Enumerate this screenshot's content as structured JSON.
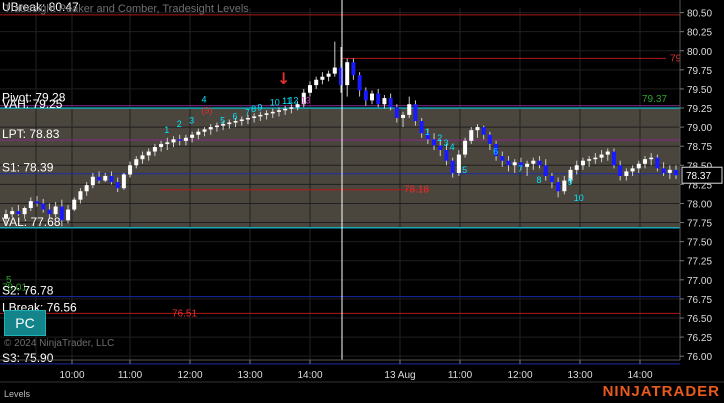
{
  "window": {
    "title": "Tradesight Peaker and Comber, Tradesight Levels",
    "copyright": "© 2024 NinjaTrader, LLC",
    "brand": "NINJATRADER",
    "panel_label": "Levels",
    "pc_button": "PC"
  },
  "colors": {
    "background": "#000000",
    "value_area_fill": "#4a463e",
    "up_candle": "#ffffff",
    "down_candle": "#1a1aff",
    "wick": "#cccccc",
    "axis_text": "#dddddd",
    "cyan": "#00e5ff",
    "red_line": "#b01818",
    "blue_line": "#1c2aa8",
    "purple_line": "#8a2a8a",
    "green_text": "#2aa52a",
    "red_text": "#e03030",
    "magenta_text": "#d040d0"
  },
  "chart_data": {
    "type": "candlestick",
    "ylim": [
      75.89,
      80.66
    ],
    "x_ticks": [
      "10:00",
      "11:00",
      "12:00",
      "13:00",
      "14:00",
      "13 Aug",
      "11:00",
      "12:00",
      "13:00",
      "14:00"
    ],
    "y_ticks": [
      "80.50",
      "80.25",
      "80.00",
      "79.75",
      "79.50",
      "79.25",
      "79.00",
      "78.75",
      "78.50",
      "78.25",
      "78.00",
      "77.75",
      "77.50",
      "77.25",
      "77.00",
      "76.75",
      "76.50",
      "76.25",
      "76.00"
    ],
    "last_price": "78.37",
    "levels": [
      {
        "name": "UBreak",
        "label": "UBreak: 80.47",
        "value": 80.47,
        "color": "#b01818"
      },
      {
        "name": "Pivot",
        "label": "Pivot: 79.28",
        "value": 79.28,
        "color": "#8a2a8a"
      },
      {
        "name": "VAH",
        "label": "VAH: 79.25",
        "value": 79.25,
        "color": "#00e5ff"
      },
      {
        "name": "LPT",
        "label": "LPT: 78.83",
        "value": 78.83,
        "color": "#8a2a8a"
      },
      {
        "name": "S1",
        "label": "S1: 78.39",
        "value": 78.39,
        "color": "#1c2aa8"
      },
      {
        "name": "VAL",
        "label": "VAL: 77.68",
        "value": 77.68,
        "color": "#00e5ff"
      },
      {
        "name": "S2",
        "label": "S2: 76.78",
        "value": 76.78,
        "color": "#1c2aa8"
      },
      {
        "name": "LBreak",
        "label": "LBreak: 76.56",
        "value": 76.56,
        "color": "#b01818"
      },
      {
        "name": "S3",
        "label": "S3: 75.90",
        "value": 75.9,
        "color": "#1c2aa8"
      }
    ],
    "value_area": [
      77.68,
      79.25
    ],
    "price_labels": [
      {
        "text": "79",
        "value": 79.9,
        "color": "#e03030"
      },
      {
        "text": "79.37",
        "value": 79.37,
        "color": "#2aa52a"
      },
      {
        "text": "78.18",
        "value": 78.18,
        "color": "#e03030"
      },
      {
        "text": "76.51",
        "value": 76.56,
        "color": "#e03030"
      },
      {
        "text": "78.01",
        "value": 76.9,
        "color": "#2aa52a"
      },
      {
        "text": "5",
        "value": 77.0,
        "color": "#2aa52a"
      }
    ],
    "count_labels": [
      {
        "text": "1",
        "bar": 26,
        "value": 78.92,
        "color": "#00e5ff"
      },
      {
        "text": "2",
        "bar": 28,
        "value": 79.0,
        "color": "#00e5ff"
      },
      {
        "text": "3",
        "bar": 30,
        "value": 79.05,
        "color": "#00e5ff"
      },
      {
        "text": "4",
        "bar": 32,
        "value": 79.32,
        "color": "#00e5ff"
      },
      {
        "text": "5",
        "bar": 35,
        "value": 79.05,
        "color": "#00e5ff"
      },
      {
        "text": "6",
        "bar": 37,
        "value": 79.1,
        "color": "#00e5ff"
      },
      {
        "text": "7",
        "bar": 39,
        "value": 79.15,
        "color": "#00e5ff"
      },
      {
        "text": "8",
        "bar": 40,
        "value": 79.2,
        "color": "#00e5ff"
      },
      {
        "text": "9",
        "bar": 41,
        "value": 79.22,
        "color": "#00e5ff"
      },
      {
        "text": "10",
        "bar": 43,
        "value": 79.28,
        "color": "#00e5ff"
      },
      {
        "text": "11",
        "bar": 45,
        "value": 79.3,
        "color": "#00e5ff"
      },
      {
        "text": "12",
        "bar": 46,
        "value": 79.31,
        "color": "#00e5ff"
      },
      {
        "text": "13",
        "bar": 48,
        "value": 79.31,
        "color": "#d040d0"
      },
      {
        "text": "(9)",
        "bar": 32,
        "value": 79.18,
        "color": "#e03030"
      },
      {
        "text": "1",
        "bar": 68,
        "value": 78.9,
        "color": "#00e5ff"
      },
      {
        "text": "2",
        "bar": 70,
        "value": 78.82,
        "color": "#00e5ff"
      },
      {
        "text": "3",
        "bar": 71,
        "value": 78.75,
        "color": "#00e5ff"
      },
      {
        "text": "4",
        "bar": 72,
        "value": 78.7,
        "color": "#00e5ff"
      },
      {
        "text": "5",
        "bar": 74,
        "value": 78.4,
        "color": "#00e5ff"
      },
      {
        "text": "6",
        "bar": 79,
        "value": 78.64,
        "color": "#00e5ff"
      },
      {
        "text": "7",
        "bar": 83,
        "value": 78.41,
        "color": "#00e5ff"
      },
      {
        "text": "8",
        "bar": 86,
        "value": 78.27,
        "color": "#00e5ff"
      },
      {
        "text": "9",
        "bar": 91,
        "value": 78.24,
        "color": "#00e5ff"
      },
      {
        "text": "10",
        "bar": 92,
        "value": 78.03,
        "color": "#00e5ff"
      }
    ],
    "candles": [
      {
        "o": 77.8,
        "h": 77.92,
        "l": 77.74,
        "c": 77.86
      },
      {
        "o": 77.86,
        "h": 77.95,
        "l": 77.82,
        "c": 77.9
      },
      {
        "o": 77.9,
        "h": 77.98,
        "l": 77.84,
        "c": 77.86
      },
      {
        "o": 77.86,
        "h": 77.96,
        "l": 77.8,
        "c": 77.94
      },
      {
        "o": 77.94,
        "h": 78.08,
        "l": 77.9,
        "c": 78.03
      },
      {
        "o": 78.03,
        "h": 78.1,
        "l": 77.96,
        "c": 78.0
      },
      {
        "o": 78.0,
        "h": 78.06,
        "l": 77.88,
        "c": 77.92
      },
      {
        "o": 77.92,
        "h": 78.0,
        "l": 77.8,
        "c": 77.86
      },
      {
        "o": 77.86,
        "h": 78.02,
        "l": 77.82,
        "c": 77.96
      },
      {
        "o": 77.96,
        "h": 78.05,
        "l": 77.7,
        "c": 77.78
      },
      {
        "o": 77.78,
        "h": 77.98,
        "l": 77.74,
        "c": 77.92
      },
      {
        "o": 77.92,
        "h": 78.08,
        "l": 77.9,
        "c": 78.05
      },
      {
        "o": 78.05,
        "h": 78.2,
        "l": 78.0,
        "c": 78.16
      },
      {
        "o": 78.16,
        "h": 78.28,
        "l": 78.1,
        "c": 78.24
      },
      {
        "o": 78.24,
        "h": 78.4,
        "l": 78.2,
        "c": 78.35
      },
      {
        "o": 78.35,
        "h": 78.42,
        "l": 78.26,
        "c": 78.3
      },
      {
        "o": 78.3,
        "h": 78.4,
        "l": 78.28,
        "c": 78.36
      },
      {
        "o": 78.36,
        "h": 78.42,
        "l": 78.25,
        "c": 78.28
      },
      {
        "o": 78.28,
        "h": 78.34,
        "l": 78.15,
        "c": 78.2
      },
      {
        "o": 78.2,
        "h": 78.4,
        "l": 78.18,
        "c": 78.38
      },
      {
        "o": 78.38,
        "h": 78.55,
        "l": 78.34,
        "c": 78.5
      },
      {
        "o": 78.5,
        "h": 78.62,
        "l": 78.46,
        "c": 78.58
      },
      {
        "o": 78.58,
        "h": 78.68,
        "l": 78.52,
        "c": 78.63
      },
      {
        "o": 78.63,
        "h": 78.72,
        "l": 78.56,
        "c": 78.68
      },
      {
        "o": 78.68,
        "h": 78.78,
        "l": 78.62,
        "c": 78.74
      },
      {
        "o": 78.74,
        "h": 78.82,
        "l": 78.68,
        "c": 78.78
      },
      {
        "o": 78.78,
        "h": 78.86,
        "l": 78.7,
        "c": 78.8
      },
      {
        "o": 78.8,
        "h": 78.88,
        "l": 78.74,
        "c": 78.84
      },
      {
        "o": 78.84,
        "h": 78.9,
        "l": 78.76,
        "c": 78.82
      },
      {
        "o": 78.82,
        "h": 78.9,
        "l": 78.76,
        "c": 78.86
      },
      {
        "o": 78.86,
        "h": 78.94,
        "l": 78.8,
        "c": 78.9
      },
      {
        "o": 78.9,
        "h": 78.98,
        "l": 78.84,
        "c": 78.94
      },
      {
        "o": 78.94,
        "h": 79.0,
        "l": 78.88,
        "c": 78.97
      },
      {
        "o": 78.97,
        "h": 79.04,
        "l": 78.9,
        "c": 79.0
      },
      {
        "o": 79.0,
        "h": 79.06,
        "l": 78.94,
        "c": 79.02
      },
      {
        "o": 79.02,
        "h": 79.08,
        "l": 78.96,
        "c": 79.04
      },
      {
        "o": 79.04,
        "h": 79.1,
        "l": 78.98,
        "c": 79.06
      },
      {
        "o": 79.06,
        "h": 79.12,
        "l": 79.0,
        "c": 79.08
      },
      {
        "o": 79.08,
        "h": 79.14,
        "l": 79.02,
        "c": 79.1
      },
      {
        "o": 79.1,
        "h": 79.16,
        "l": 79.04,
        "c": 79.12
      },
      {
        "o": 79.12,
        "h": 79.18,
        "l": 79.06,
        "c": 79.14
      },
      {
        "o": 79.14,
        "h": 79.2,
        "l": 79.08,
        "c": 79.16
      },
      {
        "o": 79.16,
        "h": 79.22,
        "l": 79.1,
        "c": 79.18
      },
      {
        "o": 79.18,
        "h": 79.24,
        "l": 79.12,
        "c": 79.2
      },
      {
        "o": 79.2,
        "h": 79.26,
        "l": 79.14,
        "c": 79.22
      },
      {
        "o": 79.22,
        "h": 79.28,
        "l": 79.16,
        "c": 79.24
      },
      {
        "o": 79.24,
        "h": 79.3,
        "l": 79.18,
        "c": 79.26
      },
      {
        "o": 79.26,
        "h": 79.34,
        "l": 79.22,
        "c": 79.3
      },
      {
        "o": 79.3,
        "h": 79.5,
        "l": 79.26,
        "c": 79.45
      },
      {
        "o": 79.45,
        "h": 79.6,
        "l": 79.4,
        "c": 79.55
      },
      {
        "o": 79.55,
        "h": 79.66,
        "l": 79.5,
        "c": 79.62
      },
      {
        "o": 79.62,
        "h": 79.72,
        "l": 79.56,
        "c": 79.66
      },
      {
        "o": 79.66,
        "h": 79.74,
        "l": 79.6,
        "c": 79.7
      },
      {
        "o": 79.7,
        "h": 80.12,
        "l": 79.66,
        "c": 79.78
      },
      {
        "o": 79.78,
        "h": 80.05,
        "l": 79.45,
        "c": 79.55
      },
      {
        "o": 79.55,
        "h": 79.9,
        "l": 79.4,
        "c": 79.85
      },
      {
        "o": 79.85,
        "h": 79.9,
        "l": 79.62,
        "c": 79.68
      },
      {
        "o": 79.68,
        "h": 79.72,
        "l": 79.4,
        "c": 79.48
      },
      {
        "o": 79.48,
        "h": 79.52,
        "l": 79.28,
        "c": 79.35
      },
      {
        "o": 79.35,
        "h": 79.48,
        "l": 79.3,
        "c": 79.44
      },
      {
        "o": 79.44,
        "h": 79.5,
        "l": 79.26,
        "c": 79.3
      },
      {
        "o": 79.3,
        "h": 79.42,
        "l": 79.24,
        "c": 79.38
      },
      {
        "o": 79.38,
        "h": 79.44,
        "l": 79.22,
        "c": 79.26
      },
      {
        "o": 79.26,
        "h": 79.3,
        "l": 79.06,
        "c": 79.12
      },
      {
        "o": 79.12,
        "h": 79.2,
        "l": 79.0,
        "c": 79.16
      },
      {
        "o": 79.16,
        "h": 79.4,
        "l": 79.12,
        "c": 79.3
      },
      {
        "o": 79.3,
        "h": 79.35,
        "l": 79.02,
        "c": 79.08
      },
      {
        "o": 79.08,
        "h": 79.12,
        "l": 78.86,
        "c": 78.92
      },
      {
        "o": 78.92,
        "h": 78.98,
        "l": 78.78,
        "c": 78.84
      },
      {
        "o": 78.84,
        "h": 78.92,
        "l": 78.7,
        "c": 78.76
      },
      {
        "o": 78.76,
        "h": 78.84,
        "l": 78.62,
        "c": 78.7
      },
      {
        "o": 78.7,
        "h": 78.78,
        "l": 78.5,
        "c": 78.56
      },
      {
        "o": 78.56,
        "h": 78.6,
        "l": 78.34,
        "c": 78.4
      },
      {
        "o": 78.4,
        "h": 78.7,
        "l": 78.36,
        "c": 78.64
      },
      {
        "o": 78.64,
        "h": 78.86,
        "l": 78.6,
        "c": 78.82
      },
      {
        "o": 78.82,
        "h": 79.0,
        "l": 78.78,
        "c": 78.96
      },
      {
        "o": 78.96,
        "h": 79.04,
        "l": 78.86,
        "c": 79.0
      },
      {
        "o": 79.0,
        "h": 79.02,
        "l": 78.84,
        "c": 78.9
      },
      {
        "o": 78.9,
        "h": 78.94,
        "l": 78.7,
        "c": 78.78
      },
      {
        "o": 78.78,
        "h": 78.82,
        "l": 78.56,
        "c": 78.62
      },
      {
        "o": 78.62,
        "h": 78.68,
        "l": 78.48,
        "c": 78.56
      },
      {
        "o": 78.56,
        "h": 78.62,
        "l": 78.42,
        "c": 78.5
      },
      {
        "o": 78.5,
        "h": 78.58,
        "l": 78.4,
        "c": 78.54
      },
      {
        "o": 78.54,
        "h": 78.6,
        "l": 78.44,
        "c": 78.48
      },
      {
        "o": 78.48,
        "h": 78.56,
        "l": 78.36,
        "c": 78.52
      },
      {
        "o": 78.52,
        "h": 78.6,
        "l": 78.44,
        "c": 78.56
      },
      {
        "o": 78.56,
        "h": 78.62,
        "l": 78.46,
        "c": 78.5
      },
      {
        "o": 78.5,
        "h": 78.58,
        "l": 78.3,
        "c": 78.36
      },
      {
        "o": 78.36,
        "h": 78.4,
        "l": 78.2,
        "c": 78.28
      },
      {
        "o": 78.28,
        "h": 78.34,
        "l": 78.08,
        "c": 78.16
      },
      {
        "o": 78.16,
        "h": 78.36,
        "l": 78.12,
        "c": 78.3
      },
      {
        "o": 78.3,
        "h": 78.48,
        "l": 78.26,
        "c": 78.44
      },
      {
        "o": 78.44,
        "h": 78.56,
        "l": 78.38,
        "c": 78.5
      },
      {
        "o": 78.5,
        "h": 78.6,
        "l": 78.44,
        "c": 78.56
      },
      {
        "o": 78.56,
        "h": 78.62,
        "l": 78.48,
        "c": 78.58
      },
      {
        "o": 78.58,
        "h": 78.66,
        "l": 78.52,
        "c": 78.6
      },
      {
        "o": 78.6,
        "h": 78.7,
        "l": 78.54,
        "c": 78.64
      },
      {
        "o": 78.64,
        "h": 78.72,
        "l": 78.56,
        "c": 78.68
      },
      {
        "o": 78.68,
        "h": 78.72,
        "l": 78.46,
        "c": 78.5
      },
      {
        "o": 78.5,
        "h": 78.56,
        "l": 78.3,
        "c": 78.36
      },
      {
        "o": 78.36,
        "h": 78.46,
        "l": 78.3,
        "c": 78.42
      },
      {
        "o": 78.42,
        "h": 78.5,
        "l": 78.36,
        "c": 78.46
      },
      {
        "o": 78.46,
        "h": 78.56,
        "l": 78.4,
        "c": 78.52
      },
      {
        "o": 78.52,
        "h": 78.62,
        "l": 78.46,
        "c": 78.58
      },
      {
        "o": 78.58,
        "h": 78.66,
        "l": 78.5,
        "c": 78.6
      },
      {
        "o": 78.6,
        "h": 78.64,
        "l": 78.42,
        "c": 78.46
      },
      {
        "o": 78.46,
        "h": 78.54,
        "l": 78.36,
        "c": 78.4
      },
      {
        "o": 78.4,
        "h": 78.5,
        "l": 78.32,
        "c": 78.44
      },
      {
        "o": 78.44,
        "h": 78.5,
        "l": 78.32,
        "c": 78.37
      }
    ]
  }
}
